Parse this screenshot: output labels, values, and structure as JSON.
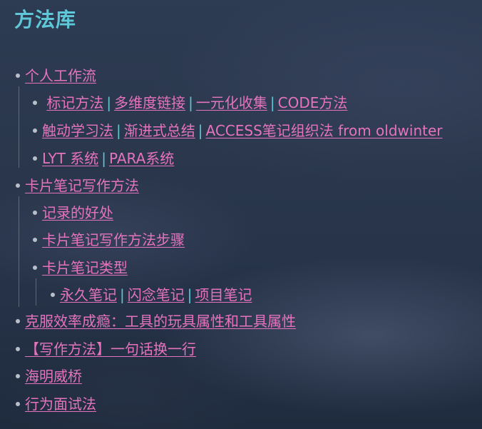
{
  "title": "方法库",
  "items": [
    {
      "label": "个人工作流"
    },
    {
      "links": [
        "标记方法",
        "多维度链接",
        "一元化收集",
        "CODE方法"
      ]
    },
    {
      "links": [
        "触动学习法",
        "渐进式总结",
        "ACCESS笔记组织法 from oldwinter"
      ]
    },
    {
      "links": [
        "LYT 系统",
        "PARA系统"
      ]
    },
    {
      "label": "卡片笔记写作方法"
    },
    {
      "label": "记录的好处"
    },
    {
      "label": "卡片笔记写作方法步骤"
    },
    {
      "label": "卡片笔记类型"
    },
    {
      "links": [
        "永久笔记",
        "闪念笔记",
        "项目笔记"
      ]
    },
    {
      "label": "克服效率成瘾：工具的玩具属性和工具属性"
    },
    {
      "label": "【写作方法】一句话换一行"
    },
    {
      "label": "海明威桥"
    },
    {
      "label": "行为面试法"
    }
  ],
  "separator": "|",
  "colors": {
    "title": "#5ec8d8",
    "link": "#e673bd",
    "separator": "#63c3d3",
    "bullet": "#b9bfca"
  }
}
